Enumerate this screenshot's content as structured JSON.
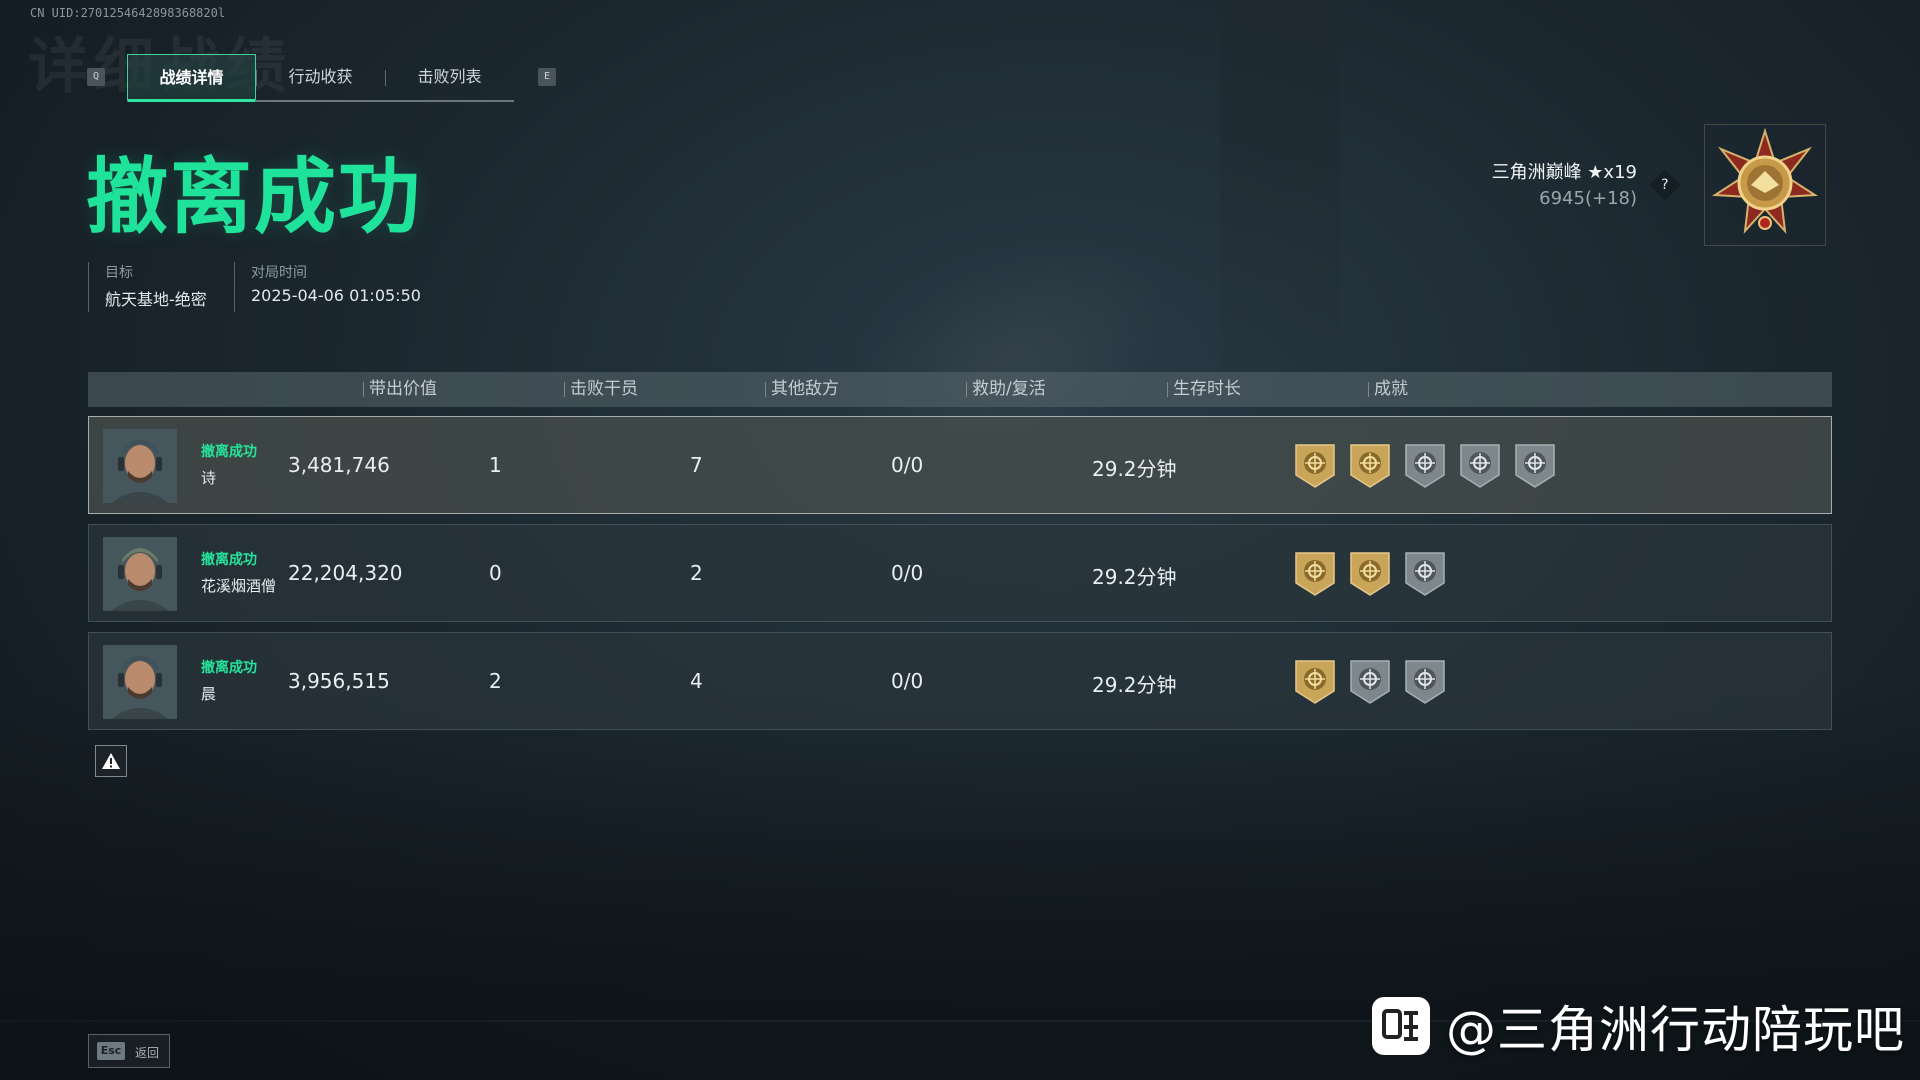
{
  "uid": "CN UID:2701254642898368820l",
  "ghost_title": "详细战绩",
  "tabs": {
    "left_key": "Q",
    "right_key": "E",
    "items": [
      {
        "label": "战绩详情",
        "active": true
      },
      {
        "label": "行动收获",
        "active": false
      },
      {
        "label": "击败列表",
        "active": false
      }
    ]
  },
  "result_title": "撤离成功",
  "meta": {
    "target_label": "目标",
    "target_value": "航天基地-绝密",
    "time_label": "对局时间",
    "time_value": "2025-04-06 01:05:50"
  },
  "rank": {
    "name": "三角洲巅峰 ★x19",
    "score": "6945(+18)",
    "help": "?"
  },
  "table": {
    "headers": [
      "带出价值",
      "击败干员",
      "其他敌方",
      "救助/复活",
      "生存时长",
      "成就"
    ],
    "rows": [
      {
        "status": "撤离成功",
        "name": "诗",
        "value": "3,481,746",
        "kills": "1",
        "others": "7",
        "assist": "0/0",
        "survival": "29.2分钟",
        "achievements": [
          "gold-crest-badge-icon",
          "gold-soldier-badge-icon",
          "crosshair-badge-icon",
          "star-burst-badge-icon",
          "handshake-badge-icon"
        ]
      },
      {
        "status": "撤离成功",
        "name": "花溪烟酒僧",
        "value": "22,204,320",
        "kills": "0",
        "others": "2",
        "assist": "0/0",
        "survival": "29.2分钟",
        "achievements": [
          "gold-crest-badge-icon",
          "gold-shield-badge-icon",
          "handshake-badge-icon"
        ]
      },
      {
        "status": "撤离成功",
        "name": "晨",
        "value": "3,956,515",
        "kills": "2",
        "others": "4",
        "assist": "0/0",
        "survival": "29.2分钟",
        "achievements": [
          "gold-crest-badge-icon",
          "crosshair-badge-icon",
          "handshake-badge-icon"
        ]
      }
    ]
  },
  "footer": {
    "esc_key": "Esc",
    "esc_label": "返回"
  },
  "watermark": "@三角洲行动陪玩吧",
  "colors": {
    "accent_green": "#1fe39b",
    "gold": "#c9a55a"
  }
}
